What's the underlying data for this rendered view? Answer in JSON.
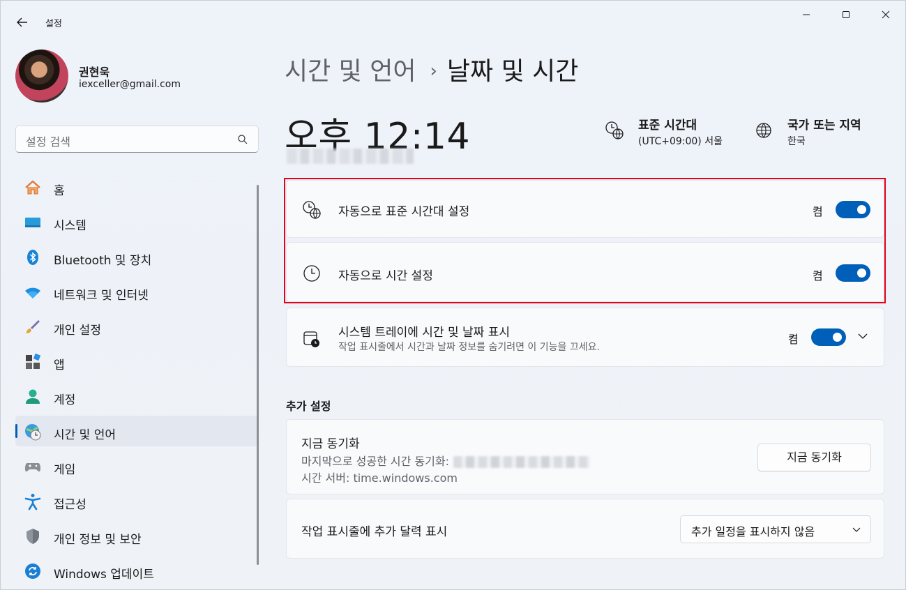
{
  "window": {
    "title": "설정"
  },
  "profile": {
    "name": "권현욱",
    "email": "iexceller@gmail.com"
  },
  "search": {
    "placeholder": "설정 검색"
  },
  "nav": {
    "items": [
      {
        "label": "홈",
        "icon": "home-icon"
      },
      {
        "label": "시스템",
        "icon": "system-icon"
      },
      {
        "label": "Bluetooth 및 장치",
        "icon": "bluetooth-icon"
      },
      {
        "label": "네트워크 및 인터넷",
        "icon": "wifi-icon"
      },
      {
        "label": "개인 설정",
        "icon": "brush-icon"
      },
      {
        "label": "앱",
        "icon": "apps-icon"
      },
      {
        "label": "계정",
        "icon": "account-icon"
      },
      {
        "label": "시간 및 언어",
        "icon": "time-language-icon",
        "active": true
      },
      {
        "label": "게임",
        "icon": "gamepad-icon"
      },
      {
        "label": "접근성",
        "icon": "accessibility-icon"
      },
      {
        "label": "개인 정보 및 보안",
        "icon": "shield-icon"
      },
      {
        "label": "Windows 업데이트",
        "icon": "update-icon"
      }
    ]
  },
  "breadcrumb": {
    "parent": "시간 및 언어",
    "separator": "›",
    "current": "날짜 및 시간"
  },
  "clock": {
    "time": "오후 12:14"
  },
  "timezone": {
    "title": "표준 시간대",
    "value": "(UTC+09:00) 서울"
  },
  "region": {
    "title": "국가 또는 지역",
    "value": "한국"
  },
  "settings": {
    "auto_timezone": {
      "label": "자동으로 표준 시간대 설정",
      "state": "켬"
    },
    "auto_time": {
      "label": "자동으로 시간 설정",
      "state": "켬"
    },
    "tray": {
      "label": "시스템 트레이에 시간 및 날짜 표시",
      "description": "작업 표시줄에서 시간과 날짜 정보를 숨기려면 이 기능을 끄세요.",
      "state": "켬"
    }
  },
  "additional": {
    "section_title": "추가 설정",
    "sync": {
      "title": "지금 동기화",
      "last_sync_label": "마지막으로 성공한 시간 동기화:",
      "server": "시간 서버: time.windows.com",
      "button": "지금 동기화"
    },
    "calendar": {
      "label": "작업 표시줄에 추가 달력 표시",
      "selected": "추가 일정을 표시하지 않음"
    }
  },
  "colors": {
    "accent": "#005fb8",
    "highlight_frame": "#e3001b"
  }
}
